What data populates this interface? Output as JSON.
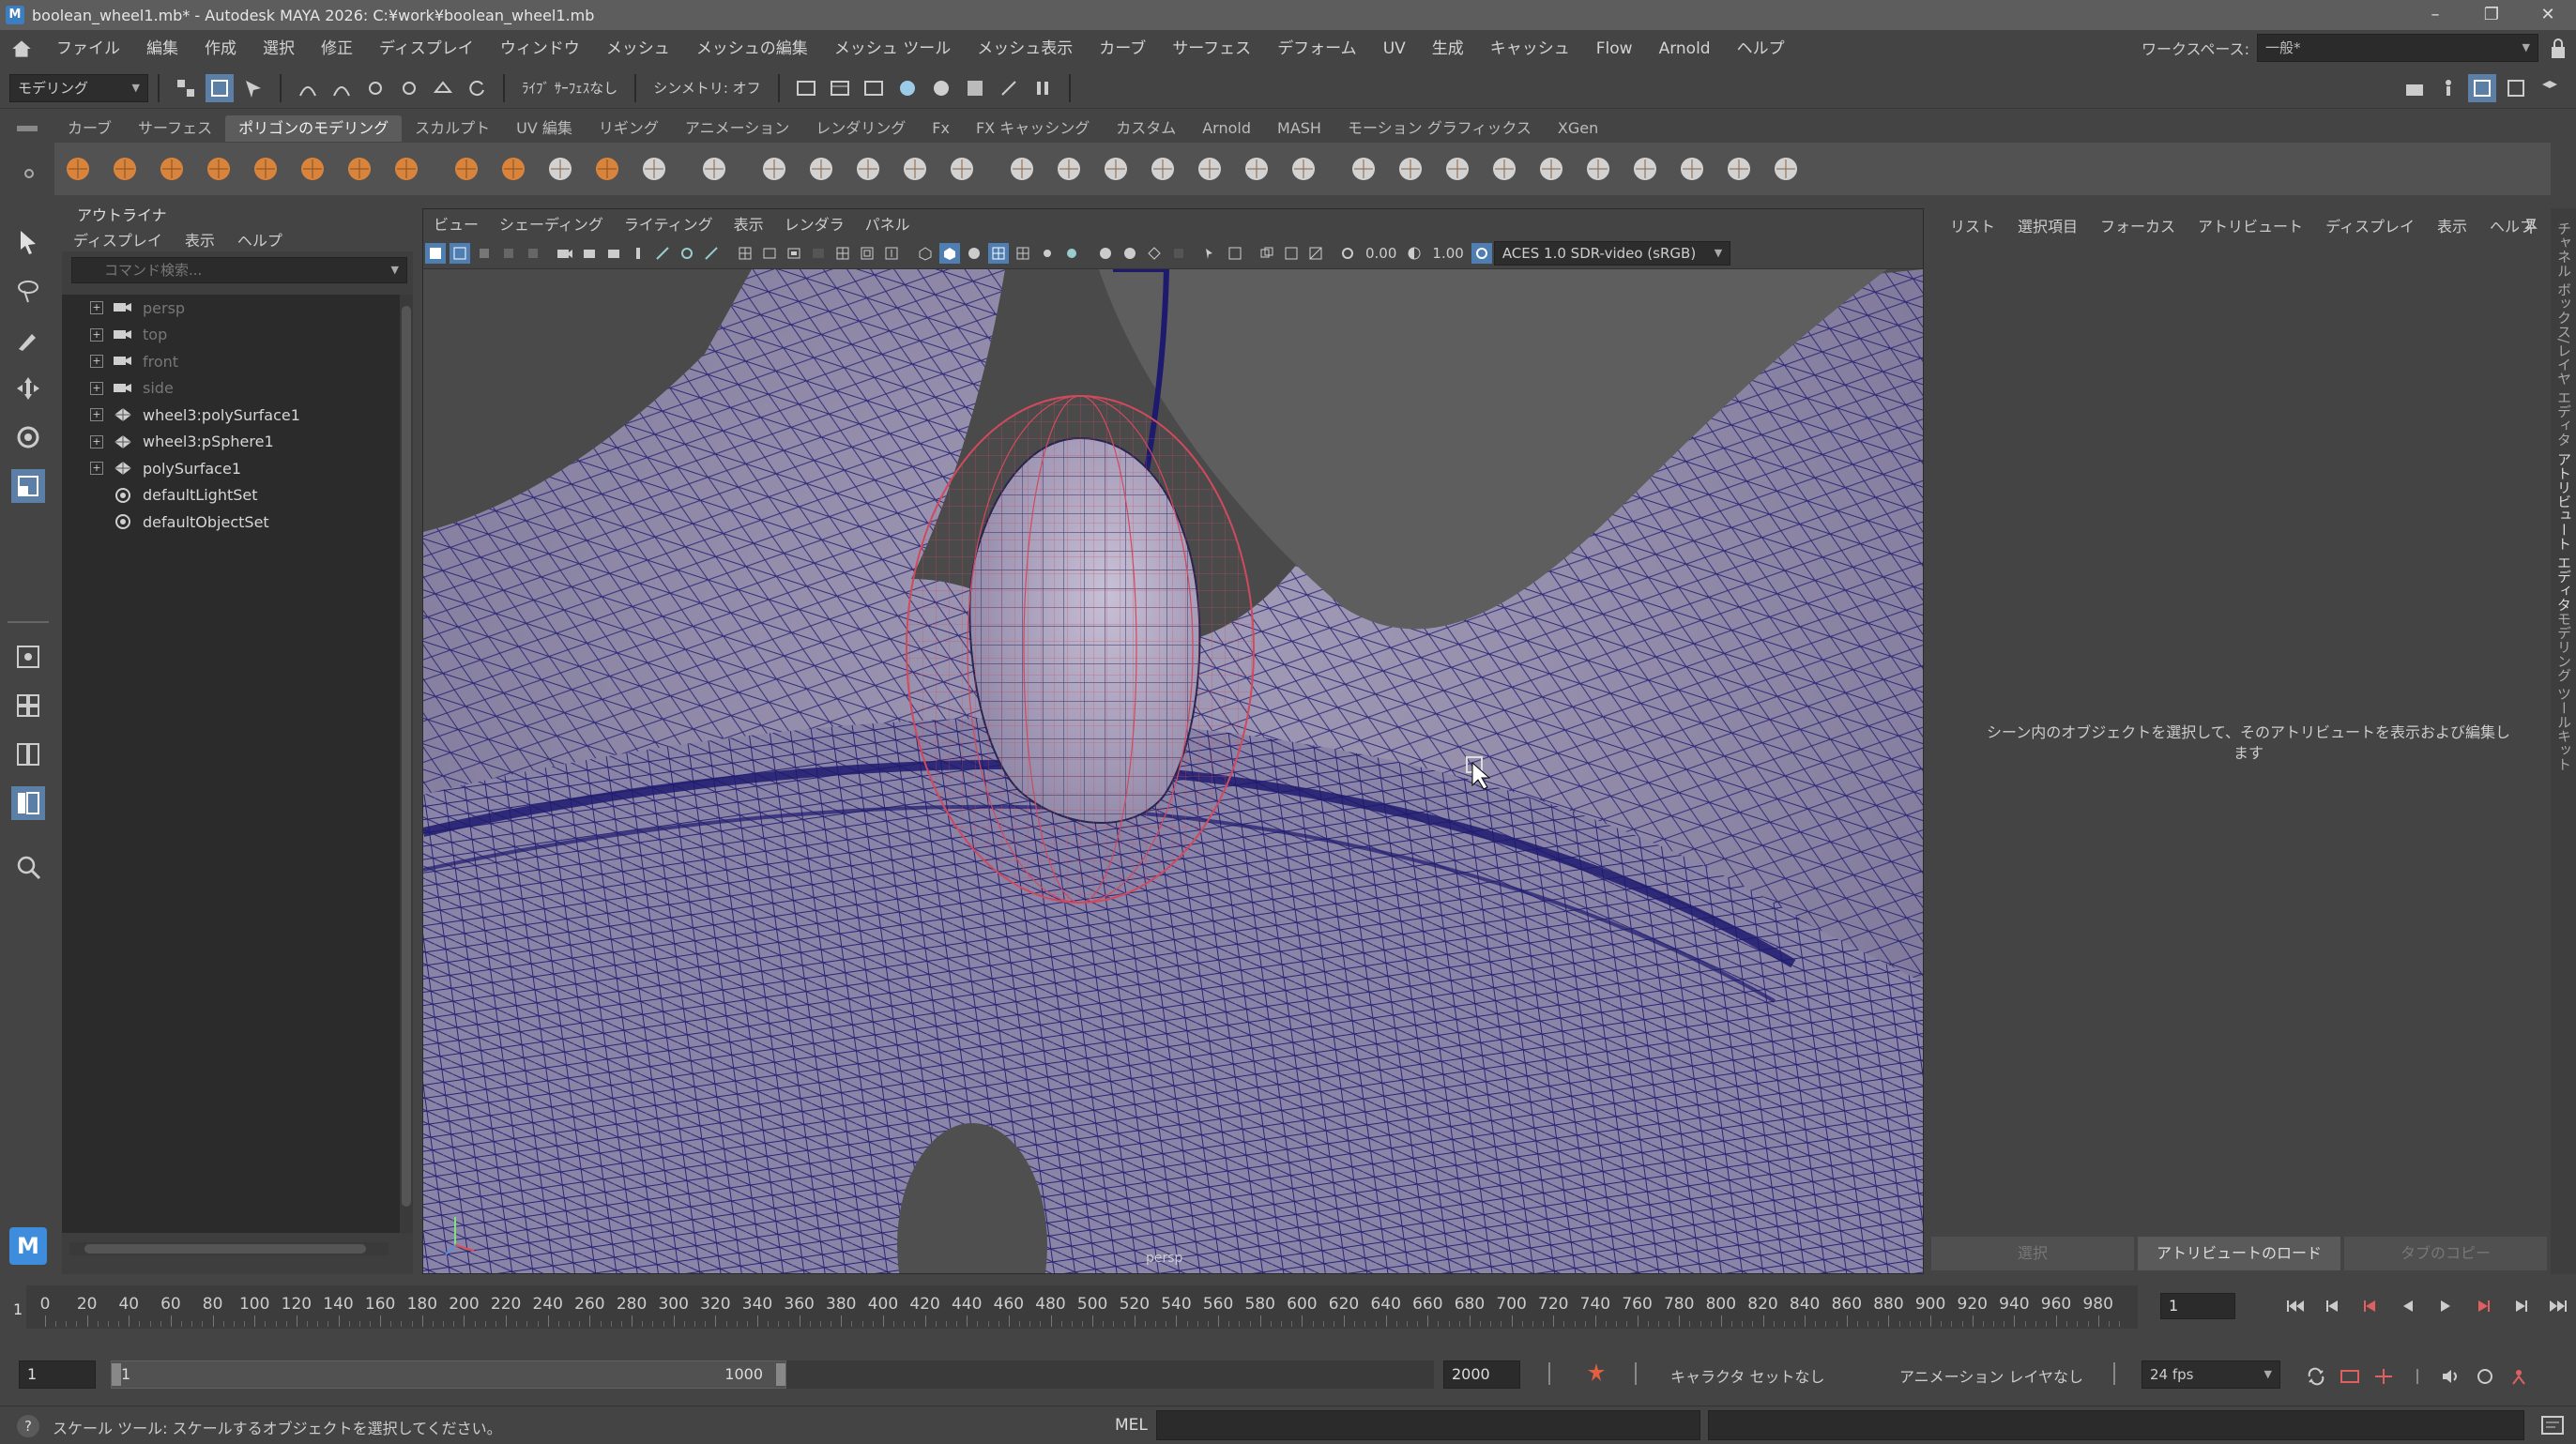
{
  "window": {
    "title": "boolean_wheel1.mb* - Autodesk MAYA 2026: C:¥work¥boolean_wheel1.mb",
    "controls": [
      "–",
      "❐",
      "✕"
    ]
  },
  "menubar": {
    "items": [
      "ファイル",
      "編集",
      "作成",
      "選択",
      "修正",
      "ディスプレイ",
      "ウィンドウ",
      "メッシュ",
      "メッシュの編集",
      "メッシュ ツール",
      "メッシュ表示",
      "カーブ",
      "サーフェス",
      "デフォーム",
      "UV",
      "生成",
      "キャッシュ",
      "Flow",
      "Arnold",
      "ヘルプ"
    ],
    "workspace_label": "ワークスペース:",
    "workspace_value": "一般*"
  },
  "statusline": {
    "mode": "モデリング",
    "live_surface": "ﾗｲﾌﾞ  ｻｰﾌｪｽなし",
    "symmetry": "シンメトリ: オフ"
  },
  "shelf": {
    "tabs": [
      "カーブ",
      "サーフェス",
      "ポリゴンのモデリング",
      "スカルプト",
      "UV 編集",
      "リギング",
      "アニメーション",
      "レンダリング",
      "Fx",
      "FX キャッシング",
      "カスタム",
      "Arnold",
      "MASH",
      "モーション グラフィックス",
      "XGen"
    ],
    "active_tab": 2
  },
  "outliner": {
    "title": "アウトライナ",
    "menu": [
      "ディスプレイ",
      "表示",
      "ヘルプ"
    ],
    "search_placeholder": "コマンド検索...",
    "items": [
      {
        "label": "persp",
        "dim": true,
        "icon": "camera-icon"
      },
      {
        "label": "top",
        "dim": true,
        "icon": "camera-icon"
      },
      {
        "label": "front",
        "dim": true,
        "icon": "camera-icon"
      },
      {
        "label": "side",
        "dim": true,
        "icon": "camera-icon"
      },
      {
        "label": "wheel3:polySurface1",
        "dim": false,
        "icon": "mesh-icon"
      },
      {
        "label": "wheel3:pSphere1",
        "dim": false,
        "icon": "mesh-icon"
      },
      {
        "label": "polySurface1",
        "dim": false,
        "icon": "mesh-icon"
      },
      {
        "label": "defaultLightSet",
        "dim": false,
        "icon": "set-icon"
      },
      {
        "label": "defaultObjectSet",
        "dim": false,
        "icon": "set-icon"
      }
    ]
  },
  "viewport": {
    "menu": [
      "ビュー",
      "シェーディング",
      "ライティング",
      "表示",
      "レンダラ",
      "パネル"
    ],
    "exposure": "0.00",
    "gamma": "1.00",
    "colorspace": "ACES 1.0 SDR-video (sRGB)",
    "camera": "persp"
  },
  "attribute_editor": {
    "menu": [
      "リスト",
      "選択項目",
      "フォーカス",
      "アトリビュート",
      "ディスプレイ",
      "表示",
      "ヘルプ"
    ],
    "message": "シーン内のオブジェクトを選択して、そのアトリビュートを表示および編集します",
    "buttons": [
      "選択",
      "アトリビュートのロード",
      "タブのコピー"
    ]
  },
  "side_tabs": [
    "チャネル ボックス/レイヤ エディタ",
    "アトリビュート エディタ",
    "モデリング ツールキット"
  ],
  "timeslider": {
    "ticks": [
      "0",
      "20",
      "40",
      "60",
      "80",
      "100",
      "120",
      "140",
      "160",
      "180",
      "200",
      "220",
      "240",
      "260",
      "280",
      "300",
      "320",
      "340",
      "360",
      "380",
      "400",
      "420",
      "440",
      "460",
      "480",
      "500",
      "520",
      "540",
      "560",
      "580",
      "600",
      "620",
      "640",
      "660",
      "680",
      "700",
      "720",
      "740",
      "760",
      "780",
      "800",
      "820",
      "840",
      "860",
      "880",
      "900",
      "920",
      "940",
      "960",
      "980"
    ],
    "current_marker": "1",
    "current_frame": "1"
  },
  "rangeslider": {
    "start": "1",
    "playback_start": "1",
    "playback_end": "1000",
    "end": "2000",
    "character_set": "キャラクタ セットなし",
    "anim_layer": "アニメーション レイヤなし",
    "fps": "24 fps"
  },
  "helpline": {
    "text": "スケール ツール: スケールするオブジェクトを選択してください。",
    "mel_label": "MEL"
  },
  "logo_text": "M",
  "colors": {
    "wire": "#1e1a6e",
    "mesh_fill": "#8c86a8",
    "sphere_wire": "#d04a5e",
    "accent": "#3e8ddc"
  }
}
